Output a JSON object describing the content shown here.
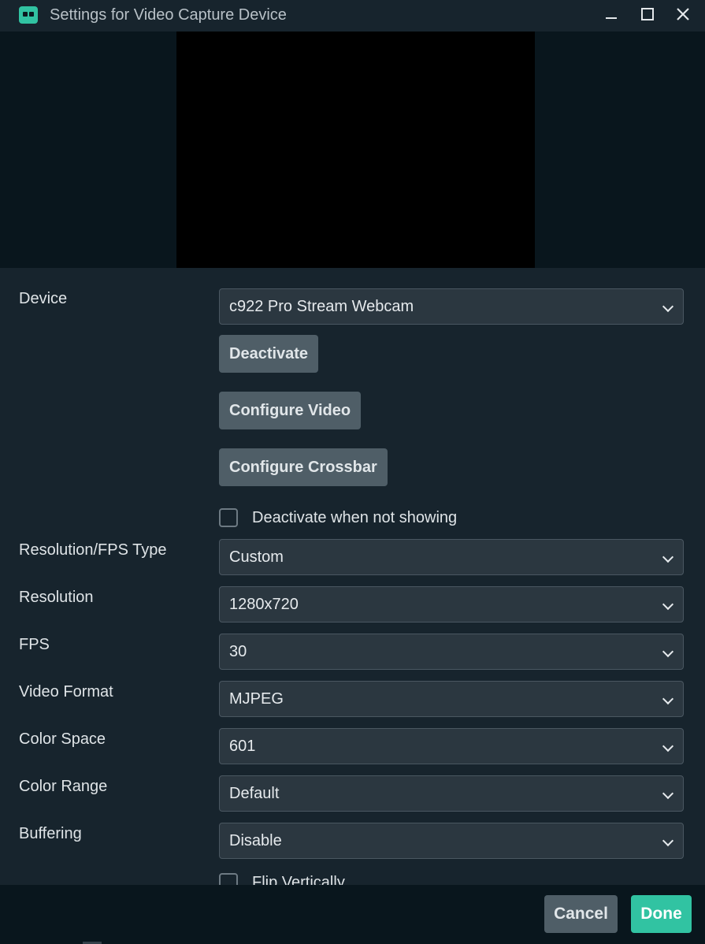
{
  "window": {
    "title": "Settings for Video Capture Device"
  },
  "device": {
    "label": "Device",
    "value": "c922 Pro Stream Webcam",
    "buttons": {
      "deactivate": "Deactivate",
      "configure_video": "Configure Video",
      "configure_crossbar": "Configure Crossbar"
    },
    "deactivate_when_not_showing": {
      "label": "Deactivate when not showing",
      "checked": false
    }
  },
  "fields": {
    "resolution_fps_type": {
      "label": "Resolution/FPS Type",
      "value": "Custom"
    },
    "resolution": {
      "label": "Resolution",
      "value": "1280x720"
    },
    "fps": {
      "label": "FPS",
      "value": "30"
    },
    "video_format": {
      "label": "Video Format",
      "value": "MJPEG"
    },
    "color_space": {
      "label": "Color Space",
      "value": "601"
    },
    "color_range": {
      "label": "Color Range",
      "value": "Default"
    },
    "buffering": {
      "label": "Buffering",
      "value": "Disable"
    }
  },
  "flip_vertically": {
    "label": "Flip Vertically",
    "checked": false
  },
  "footer": {
    "cancel": "Cancel",
    "done": "Done",
    "peek_text": "Mi"
  },
  "colors": {
    "accent": "#31c3a2",
    "panel": "#17242d",
    "background": "#09161d",
    "button": "#4f5e67"
  }
}
